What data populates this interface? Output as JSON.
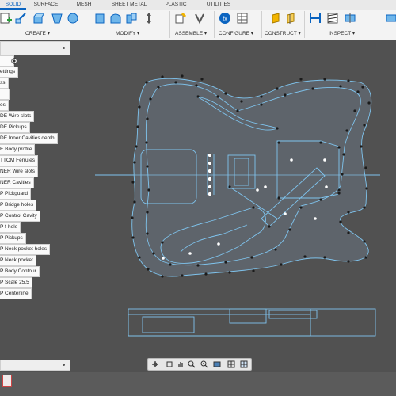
{
  "tabs": [
    "SOLID",
    "SURFACE",
    "MESH",
    "SHEET METAL",
    "PLASTIC",
    "UTILITIES"
  ],
  "toolbar_groups": [
    "CREATE ▾",
    "MODIFY ▾",
    "ASSEMBLE ▾",
    "CONFIGURE ▾",
    "CONSTRUCT ▾",
    "INSPECT ▾"
  ],
  "browser": {
    "items": [
      "ettings",
      "ss",
      "",
      "es",
      "DE Wire slots",
      "DE Pickups",
      "DE Inner Cavities depth",
      "E Body profile",
      "TTOM Ferrules",
      "NER Wire slots",
      "NER Cavities",
      "P Pickguard",
      "P Bridge holes",
      "P Control Cavity",
      "P f-hole",
      "P Pickups",
      "P Neck pocket holes",
      "P Neck pocket",
      "P Body Contour",
      "P Scale 25.5",
      "P Centerline"
    ]
  },
  "colors": {
    "accent": "#0b64c0",
    "canvas_bg": "#515151",
    "sketch_line": "#7fc4ee",
    "body_fill": "#6e7d8b"
  },
  "icons": {
    "toolbar": [
      "new-component-icon",
      "create-sketch-icon",
      "extrude-icon",
      "revolve-icon",
      "press-pull-icon",
      "fillet-icon",
      "shell-icon",
      "combine-icon",
      "new-component-assemble-icon",
      "joint-icon",
      "parameters-icon",
      "configure-table-icon",
      "offset-plane-icon",
      "midplane-icon",
      "measure-icon",
      "section-icon",
      "zebra-icon",
      "insert-icon"
    ],
    "navigation": [
      "orbit-icon",
      "pan-icon",
      "zoom-icon",
      "fit-icon",
      "display-icon",
      "grid-icon",
      "viewport-icon"
    ]
  }
}
